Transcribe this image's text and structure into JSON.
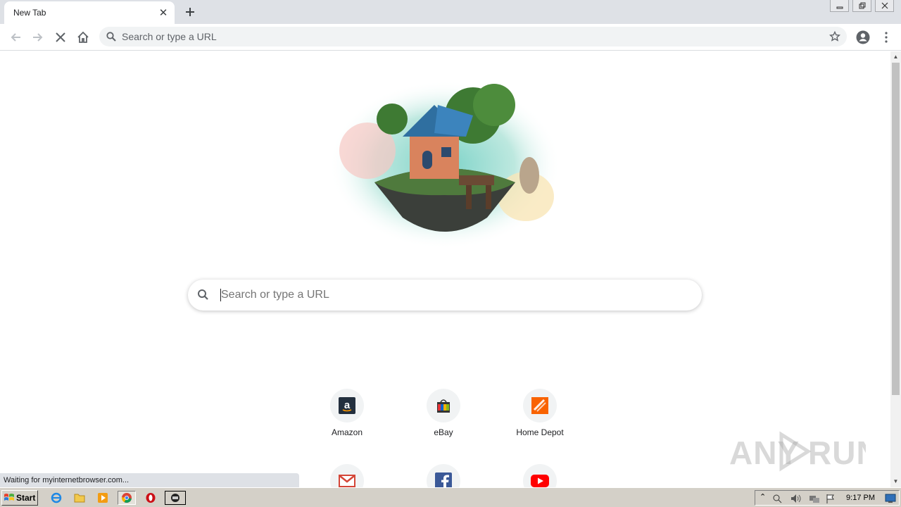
{
  "tab": {
    "title": "New Tab"
  },
  "toolbar": {
    "omnibox_placeholder": "Search or type a URL"
  },
  "page": {
    "search_placeholder": "Search or type a URL",
    "tiles_row1": [
      {
        "label": "Amazon",
        "icon": "amazon-icon"
      },
      {
        "label": "eBay",
        "icon": "ebay-icon"
      },
      {
        "label": "Home Depot",
        "icon": "home-depot-icon"
      }
    ],
    "tiles_row2": [
      {
        "icon": "gmail-icon"
      },
      {
        "icon": "facebook-icon"
      },
      {
        "icon": "youtube-icon"
      }
    ]
  },
  "status": {
    "text": "Waiting for myinternetbrowser.com..."
  },
  "watermark": {
    "text": "ANY RUN"
  },
  "taskbar": {
    "start_label": "Start",
    "clock": "9:17 PM"
  },
  "colors": {
    "tabstrip": "#dee1e6",
    "omnibox": "#f1f3f4",
    "taskbar": "#d4d0c8"
  }
}
